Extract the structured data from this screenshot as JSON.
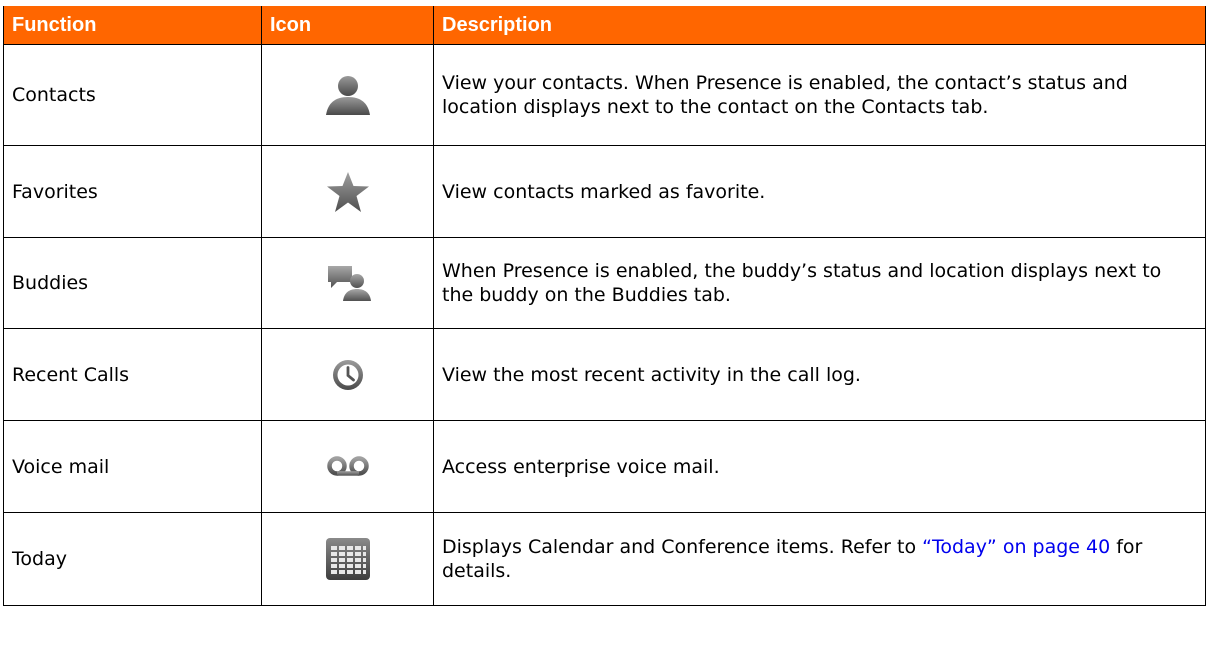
{
  "table": {
    "headers": {
      "function": "Function",
      "icon": "Icon",
      "description": "Description"
    },
    "rows": [
      {
        "function": "Contacts",
        "icon": "contact-person-icon",
        "description": "View your contacts. When Presence is enabled, the contact’s status and location displays next to the contact on the Contacts tab."
      },
      {
        "function": "Favorites",
        "icon": "star-icon",
        "description": "View contacts marked as favorite."
      },
      {
        "function": "Buddies",
        "icon": "buddies-chat-icon",
        "description": "When Presence is enabled, the buddy’s status and location displays next to the buddy on the Buddies tab."
      },
      {
        "function": "Recent Calls",
        "icon": "clock-icon",
        "description": "View the most recent activity in the call log."
      },
      {
        "function": "Voice mail",
        "icon": "voicemail-icon",
        "description": "Access enterprise voice mail."
      },
      {
        "function": "Today",
        "icon": "calendar-grid-icon",
        "description_before": "Displays Calendar and Conference items. Refer to ",
        "description_link": "“Today” on page 40",
        "description_after": " for details."
      }
    ]
  },
  "colors": {
    "header_bg": "#ff6600",
    "header_text": "#ffffff",
    "link": "#0000ee"
  }
}
